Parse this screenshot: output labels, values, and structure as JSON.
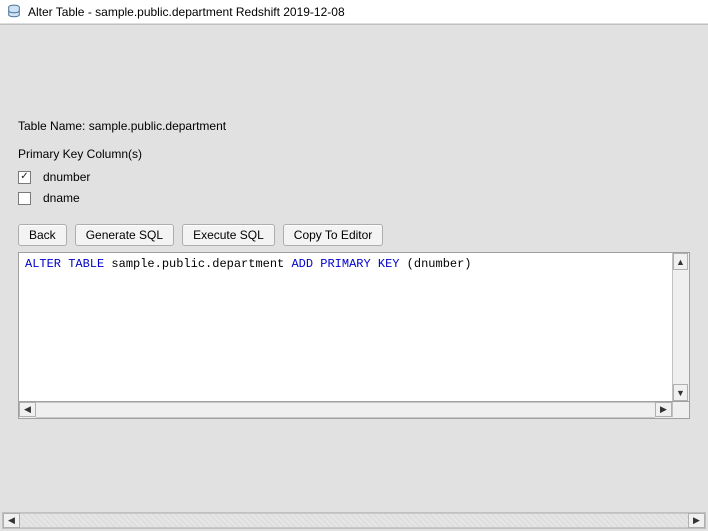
{
  "window": {
    "title": "Alter Table - sample.public.department Redshift 2019-12-08"
  },
  "table": {
    "name_label": "Table Name: sample.public.department"
  },
  "pk": {
    "heading": "Primary Key Column(s)",
    "columns": [
      {
        "name": "dnumber",
        "checked": true
      },
      {
        "name": "dname",
        "checked": false
      }
    ]
  },
  "buttons": {
    "back": "Back",
    "generate": "Generate SQL",
    "execute": "Execute SQL",
    "copy": "Copy To Editor"
  },
  "sql": {
    "kw_alter_table": "ALTER TABLE",
    "target": " sample.public.department ",
    "kw_add_pk": "ADD PRIMARY KEY",
    "tail": " (dnumber)"
  }
}
